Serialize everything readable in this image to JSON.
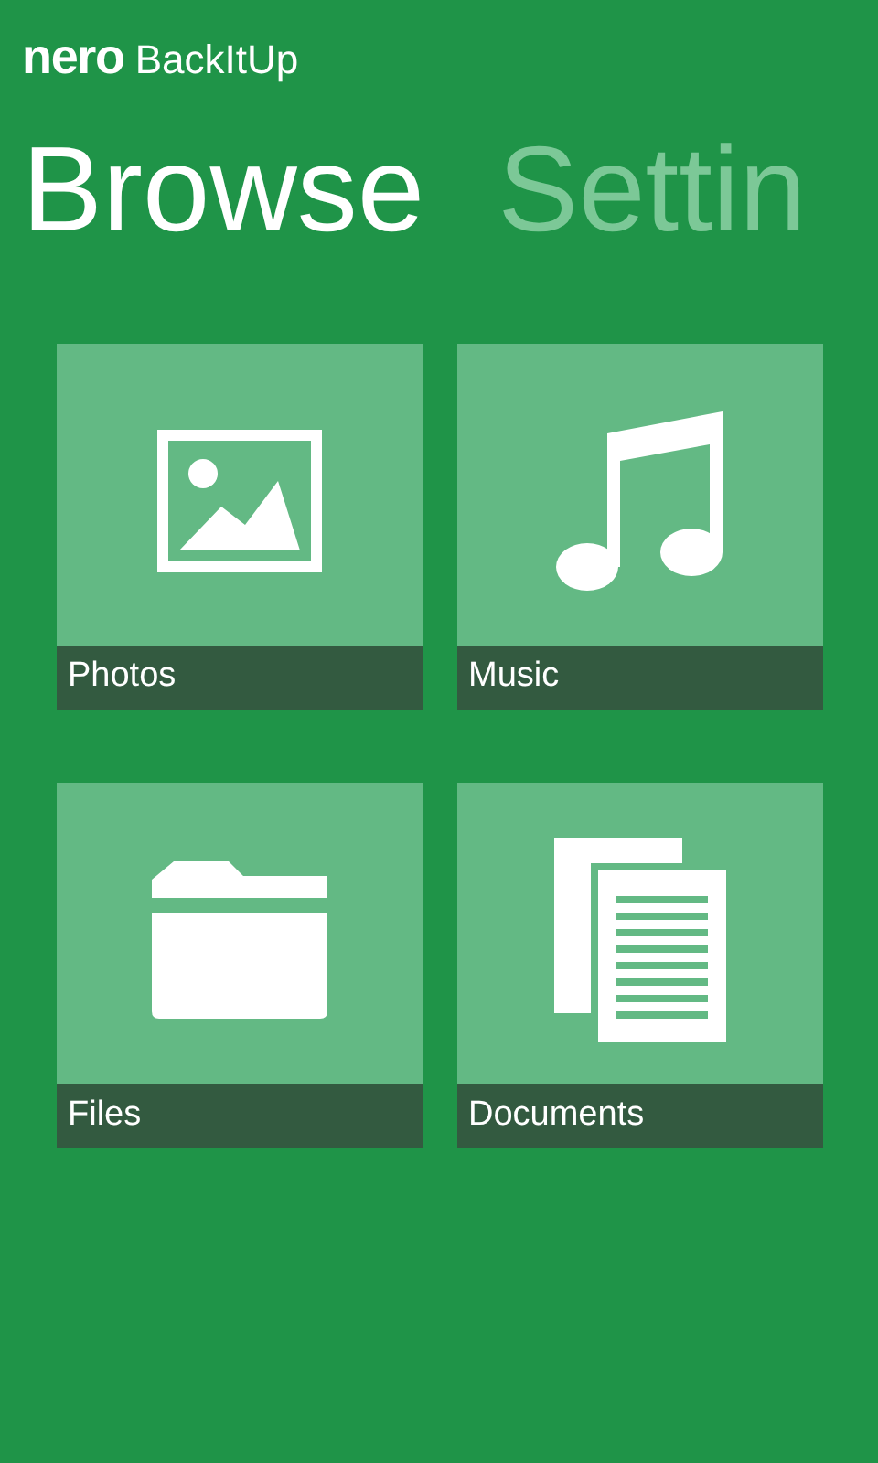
{
  "app_header": {
    "brand": "nero",
    "product": "BackItUp"
  },
  "pivot": [
    {
      "label": "Browse",
      "selected": true
    },
    {
      "label": "Settin",
      "selected": false
    }
  ],
  "tiles": [
    {
      "label": "Photos",
      "kind": "photo"
    },
    {
      "label": "Music",
      "kind": "music"
    },
    {
      "label": "Files",
      "kind": "folder"
    },
    {
      "label": "Documents",
      "kind": "document"
    }
  ]
}
